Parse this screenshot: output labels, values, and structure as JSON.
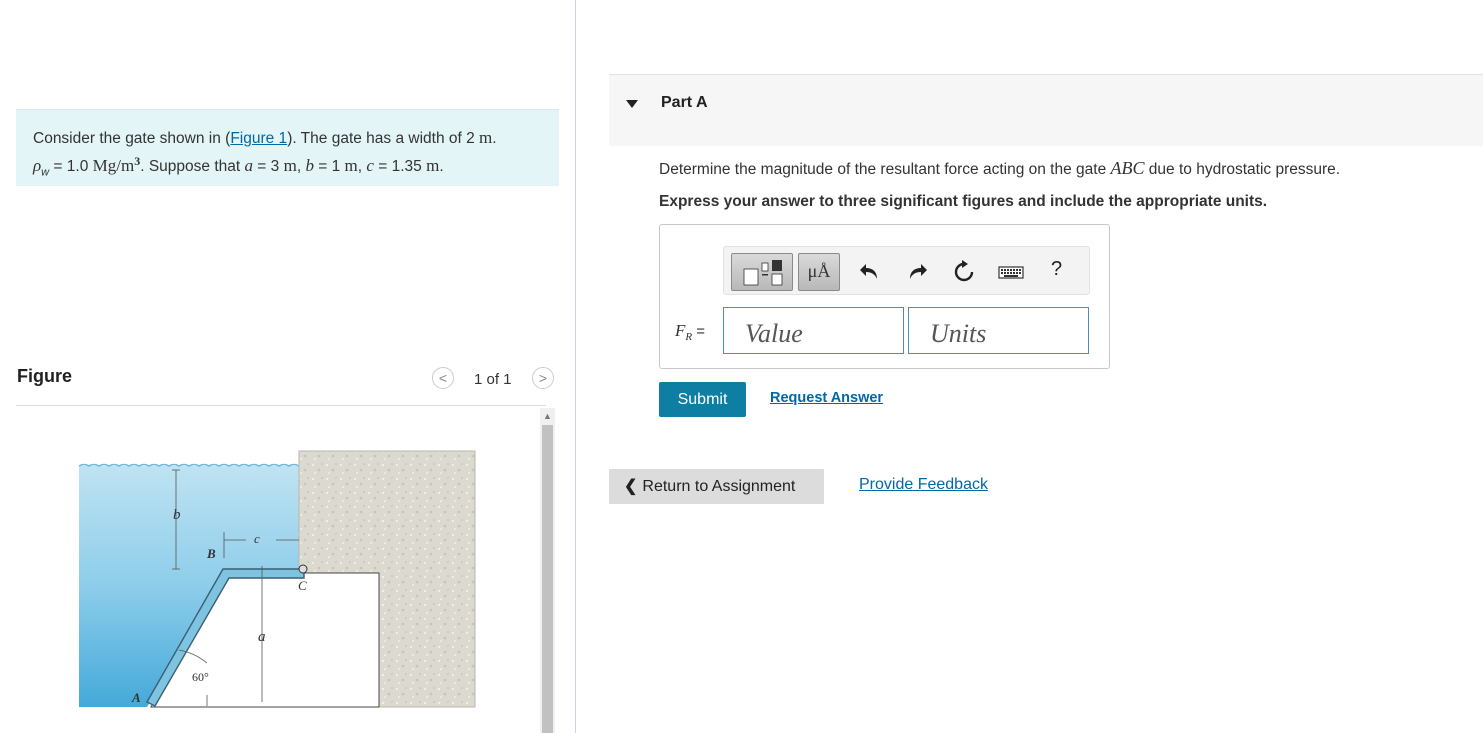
{
  "problem": {
    "intro_prefix": "Consider the gate shown in (",
    "figure_link": "Figure 1",
    "intro_mid": "). The gate has a width of 2 ",
    "unit_m": "m",
    "rho_symbol": "ρ",
    "rho_subscript": "w",
    "rho_value": " = 1.0 ",
    "rho_unit": "Mg/m",
    "rho_exp": "3",
    "suppose": ". Suppose that ",
    "var_a": "a",
    "a_val": " = 3 ",
    "var_b": "b",
    "b_val": " = 1 ",
    "var_c": "c",
    "c_val": " = 1.35 ",
    "end": "."
  },
  "figure": {
    "title": "Figure",
    "counter": "1 of 1",
    "prev_glyph": "<",
    "next_glyph": ">",
    "labels": {
      "b": "b",
      "c": "c",
      "B": "B",
      "C": "C",
      "a": "a",
      "A": "A",
      "angle": "60°"
    }
  },
  "part": {
    "title": "Part A",
    "question_prefix": "Determine the magnitude of the resultant force acting on the gate ",
    "question_var": "ABC",
    "question_suffix": " due to hydrostatic pressure.",
    "instruction": "Express your answer to three significant figures and include the appropriate units."
  },
  "answer": {
    "label_main": "F",
    "label_sub": "R",
    "label_eq": " =",
    "value_placeholder": "Value",
    "units_placeholder": "Units",
    "toolbar": {
      "unit_button": "μÅ",
      "help": "?"
    }
  },
  "actions": {
    "submit": "Submit",
    "request_answer": "Request Answer",
    "return": "Return to Assignment",
    "feedback": "Provide Feedback"
  },
  "colors": {
    "accent": "#0f7ea3",
    "link": "#0068a8",
    "problem_bg": "#e4f5f7"
  }
}
